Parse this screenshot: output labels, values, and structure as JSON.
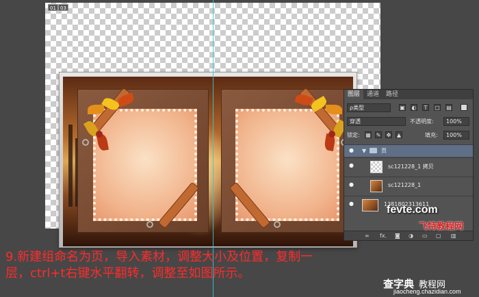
{
  "canvas": {
    "tag_a": "01",
    "tag_b": "03"
  },
  "layers_panel": {
    "tabs": [
      {
        "label": "图层",
        "active": true
      },
      {
        "label": "通道",
        "active": false
      },
      {
        "label": "路径",
        "active": false
      }
    ],
    "filter_label": "ρ类型",
    "blend_mode": "穿透",
    "opacity_label": "不透明度:",
    "opacity_value": "100%",
    "lock_label": "锁定:",
    "fill_label": "填充:",
    "fill_value": "100%",
    "layers": [
      {
        "name": "页",
        "kind": "group"
      },
      {
        "name": "sc121228_1 拷贝",
        "kind": "layer"
      },
      {
        "name": "sc121228_1",
        "kind": "layer"
      },
      {
        "name": "1381802313611",
        "kind": "layer"
      }
    ],
    "footer_icons": [
      "link-icon",
      "fx-icon",
      "mask-icon",
      "adjustment-icon",
      "new-group-icon",
      "new-layer-icon",
      "trash-icon"
    ]
  },
  "watermark": {
    "main": "fevte.com",
    "cn": "飞特教程网"
  },
  "caption": {
    "line1": "9.新建组命名为页，导入素材，调整大小及位置，复制一",
    "line2": "层，ctrl+t右键水平翻转，调整至如图所示。"
  },
  "site": {
    "name": "查字典",
    "sub": "教程网",
    "url": "jiaocheng.chazidian.com"
  },
  "colors": {
    "guide": "#35c6d9",
    "caption": "#ff2b2b",
    "group_highlight": "#5e6f87"
  }
}
